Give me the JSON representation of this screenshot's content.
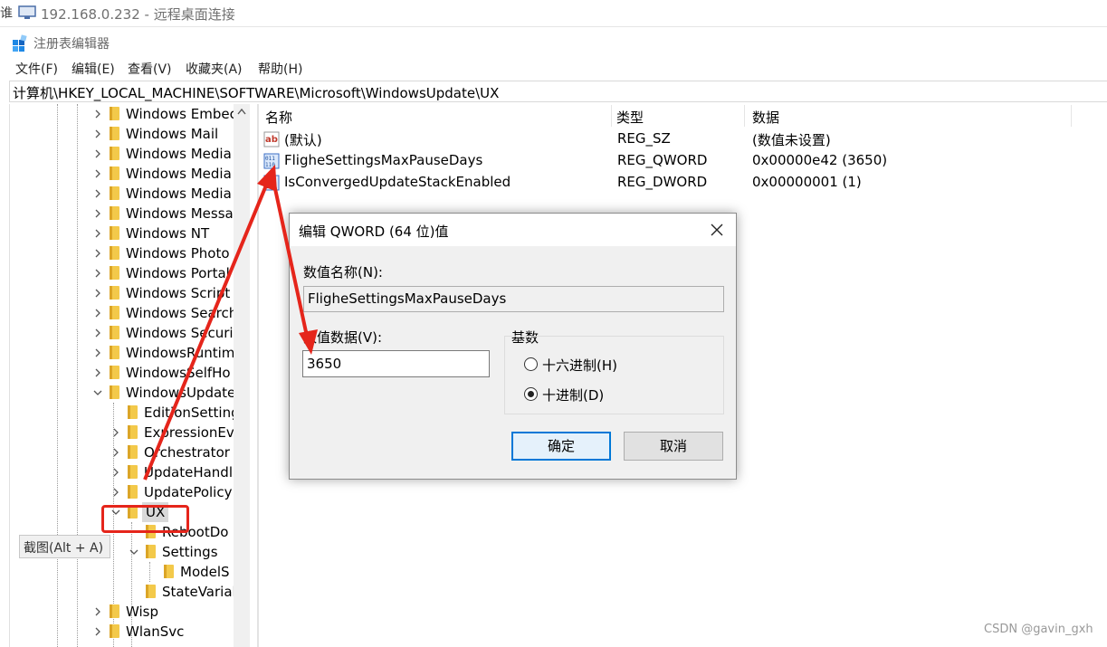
{
  "rdp": {
    "title": "192.168.0.232 - 远程桌面连接",
    "edge_char": "谁"
  },
  "app": {
    "title": "注册表编辑器"
  },
  "menu": [
    "文件(F)",
    "编辑(E)",
    "查看(V)",
    "收藏夹(A)",
    "帮助(H)"
  ],
  "address": "计算机\\HKEY_LOCAL_MACHINE\\SOFTWARE\\Microsoft\\WindowsUpdate\\UX",
  "tree": [
    "Windows Embec",
    "Windows Mail",
    "Windows Media",
    "Windows Media",
    "Windows Media",
    "Windows Messa",
    "Windows NT",
    "Windows Photo",
    "Windows Portal",
    "Windows Script",
    "Windows Search",
    "Windows Securi",
    "WindowsRuntim",
    "WindowsSelfHo",
    "WindowsUpdate",
    "EditionSetting",
    "ExpressionEva",
    "Orchestrator",
    "UpdateHandl",
    "UpdatePolicy",
    "UX",
    "RebootDo",
    "Settings",
    "ModelS",
    "StateVarial",
    "Wisp",
    "WlanSvc"
  ],
  "list": {
    "headers": {
      "name": "名称",
      "type": "类型",
      "data": "数据"
    },
    "rows": [
      {
        "icon": "string-value-icon",
        "name": "(默认)",
        "type": "REG_SZ",
        "data": "(数值未设置)"
      },
      {
        "icon": "binary-value-icon",
        "name": "FligheSettingsMaxPauseDays",
        "type": "REG_QWORD",
        "data": "0x00000e42 (3650)"
      },
      {
        "icon": "binary-value-icon",
        "name": "IsConvergedUpdateStackEnabled",
        "type": "REG_DWORD",
        "data": "0x00000001 (1)"
      }
    ]
  },
  "dialog": {
    "title": "编辑 QWORD (64 位)值",
    "name_label": "数值名称(N):",
    "name_value": "FligheSettingsMaxPauseDays",
    "data_label": "数值数据(V):",
    "data_value": "3650",
    "base_label": "基数",
    "hex_label": "十六进制(H)",
    "dec_label": "十进制(D)",
    "selected_base": "dec",
    "ok": "确定",
    "cancel": "取消"
  },
  "tooltip": "截图(Alt + A)",
  "watermark": "CSDN @gavin_gxh",
  "colors": {
    "annotation_red": "#e5251b",
    "folder": "#f3c94a",
    "default_button_border": "#0078d7"
  }
}
